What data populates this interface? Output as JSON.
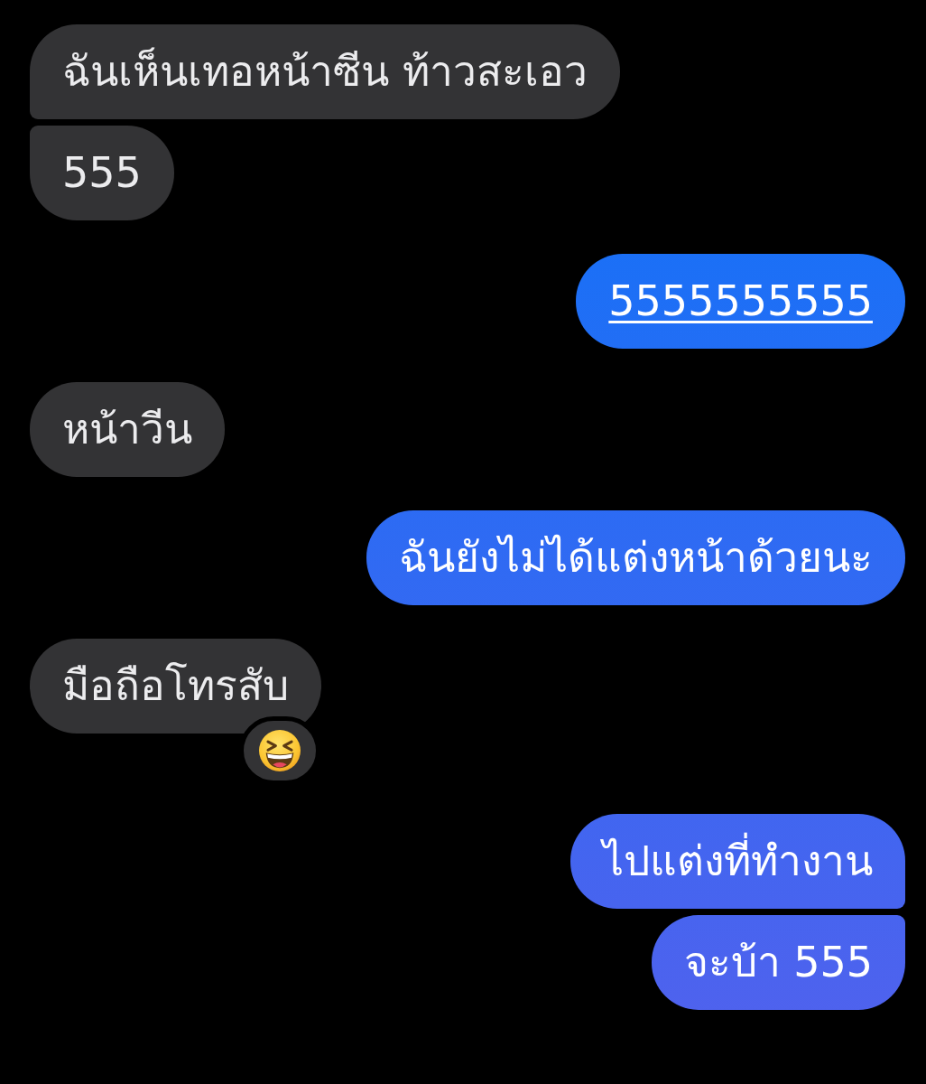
{
  "messages": [
    {
      "kind": "received",
      "text": "ฉันเห็นเทอหน้าซีน ท้าวสะเอว",
      "link": false
    },
    {
      "kind": "received",
      "text": "555",
      "link": false
    },
    {
      "kind": "sent",
      "text": "5555555555",
      "link": true
    },
    {
      "kind": "received",
      "text": "หน้าวีน",
      "link": false
    },
    {
      "kind": "sent",
      "text": "ฉันยังไม่ได้แต่งหน้าด้วยนะ",
      "link": false
    },
    {
      "kind": "received",
      "text": "มือถือโทรสับ",
      "link": false,
      "reaction": {
        "kind": "laughing"
      }
    },
    {
      "kind": "sent",
      "text": "ไปแต่งที่ทำงาน",
      "link": false
    },
    {
      "kind": "sent",
      "text": "จะบ้า 555",
      "link": false
    }
  ]
}
